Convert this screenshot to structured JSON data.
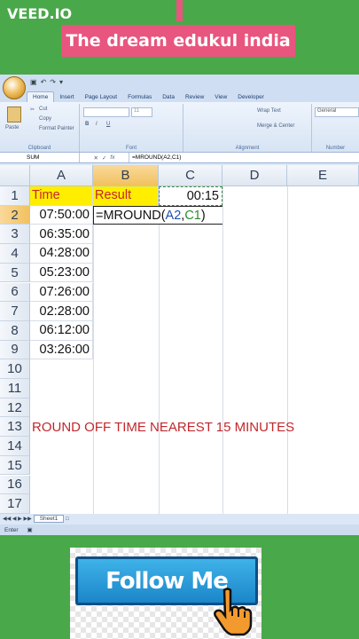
{
  "overlay": {
    "watermark": "VEED.IO",
    "banner": "The dream edukul india",
    "follow_label": "Follow Me"
  },
  "excel": {
    "tabs": [
      "Home",
      "Insert",
      "Page Layout",
      "Formulas",
      "Data",
      "Review",
      "View",
      "Developer"
    ],
    "ribbon": {
      "cut": "Cut",
      "copy": "Copy",
      "format_painter": "Format Painter",
      "paste": "Paste",
      "clipboard": "Clipboard",
      "font": "Font",
      "alignment": "Alignment",
      "number": "Number",
      "wrap_text": "Wrap Text",
      "merge_center": "Merge & Center",
      "number_format": "General",
      "font_size": "11"
    },
    "name_box": "SUM",
    "formula": "=MROUND(A2,C1)",
    "columns": [
      "A",
      "B",
      "C",
      "D",
      "E"
    ],
    "rows": [
      "1",
      "2",
      "3",
      "4",
      "5",
      "6",
      "7",
      "8",
      "9",
      "10",
      "11",
      "12",
      "13",
      "14",
      "15",
      "16",
      "17"
    ],
    "a1": "Time",
    "b1": "Result",
    "c1": "00:15",
    "times": [
      "07:50:00",
      "06:35:00",
      "04:28:00",
      "05:23:00",
      "07:26:00",
      "02:28:00",
      "06:12:00",
      "03:26:00"
    ],
    "b2_prefix": "=MROUND(",
    "b2_ref1": "A2",
    "b2_comma": ",",
    "b2_ref2": "C1",
    "b2_suffix": ")",
    "note": "ROUND OFF TIME NEAREST  15 MINUTES",
    "sheet_tab": "Sheet1",
    "status": "Enter"
  }
}
